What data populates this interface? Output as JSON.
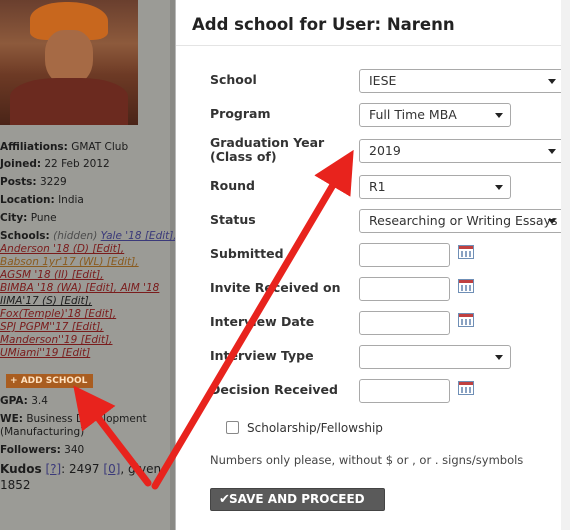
{
  "profile": {
    "affiliations_label": "Affiliations:",
    "affiliations_value": "GMAT Club",
    "joined_label": "Joined:",
    "joined_value": "22 Feb 2012",
    "posts_label": "Posts:",
    "posts_value": "3229",
    "location_label": "Location:",
    "location_value": "India",
    "city_label": "City:",
    "city_value": "Pune",
    "schools_label": "Schools:",
    "schools_hidden": "(hidden)",
    "school_lines": [
      "Yale '18 [Edit],",
      "Anderson '18 (D) [Edit],",
      "Babson 1yr'17 (WL) [Edit],",
      "AGSM '18 (II) [Edit],",
      "BIMBA '18 (WA) [Edit], AIM '18",
      "IIMA'17 (S) [Edit],",
      "Fox(Temple)'18 [Edit],",
      "SPJ PGPM''17 [Edit],",
      "Manderson''19 [Edit],",
      "UMiami''19 [Edit]"
    ],
    "add_school": "ADD SCHOOL",
    "gpa_label": "GPA:",
    "gpa_value": "3.4",
    "we_label": "WE:",
    "we_value": "Business Development",
    "we_value2": "(Manufacturing)",
    "followers_label": "Followers:",
    "followers_value": "340",
    "kudos_label": "Kudos",
    "kudos_q": "[?]",
    "kudos_value": ": 2497",
    "kudos_zero": "[0]",
    "kudos_given": ", given:",
    "kudos_given_value": "1852"
  },
  "modal": {
    "title": "Add school for User: Narenn",
    "fields": {
      "school_label": "School",
      "school_value": "IESE",
      "program_label": "Program",
      "program_value": "Full Time MBA",
      "grad_label_1": "Graduation Year",
      "grad_label_2": "(Class of)",
      "grad_value": "2019",
      "round_label": "Round",
      "round_value": "R1",
      "status_label": "Status",
      "status_value": "Researching or Writing Essays",
      "submitted_label": "Submitted",
      "invite_label": "Invite Received on",
      "interview_date_label": "Interview Date",
      "interview_type_label": "Interview Type",
      "interview_type_value": "",
      "decision_label": "Decision Received"
    },
    "scholarship_label": "Scholarship/Fellowship",
    "note": "Numbers only please, without $ or , or . signs/symbols",
    "save_label": "SAVE AND PROCEED",
    "save_icon": "check-icon"
  },
  "colors": {
    "arrow": "#e8231d",
    "add_school_button": "#a95d20",
    "save_button": "#5a5a5a"
  }
}
